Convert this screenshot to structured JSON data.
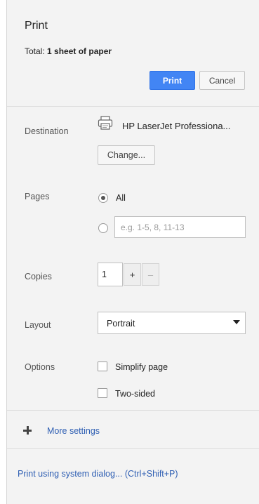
{
  "header": {
    "title": "Print",
    "summary_prefix": "Total: ",
    "summary_value": "1 sheet of paper",
    "print_label": "Print",
    "cancel_label": "Cancel"
  },
  "destination": {
    "label": "Destination",
    "printer_name": "HP LaserJet Professiona...",
    "change_label": "Change..."
  },
  "pages": {
    "label": "Pages",
    "all_label": "All",
    "range_placeholder": "e.g. 1-5, 8, 11-13",
    "range_value": ""
  },
  "copies": {
    "label": "Copies",
    "value": "1",
    "plus": "+",
    "minus": "–"
  },
  "layout": {
    "label": "Layout",
    "selected": "Portrait"
  },
  "options": {
    "label": "Options",
    "simplify_label": "Simplify page",
    "simplify_checked": false,
    "two_sided_label": "Two-sided",
    "two_sided_checked": false
  },
  "more_settings": {
    "label": "More settings"
  },
  "system_dialog": {
    "label": "Print using system dialog... (Ctrl+Shift+P)"
  },
  "colors": {
    "accent": "#4285f4",
    "link": "#2f5fb3",
    "panel_bg": "#f3f3f3",
    "side_strip": "#6d2a3b"
  }
}
